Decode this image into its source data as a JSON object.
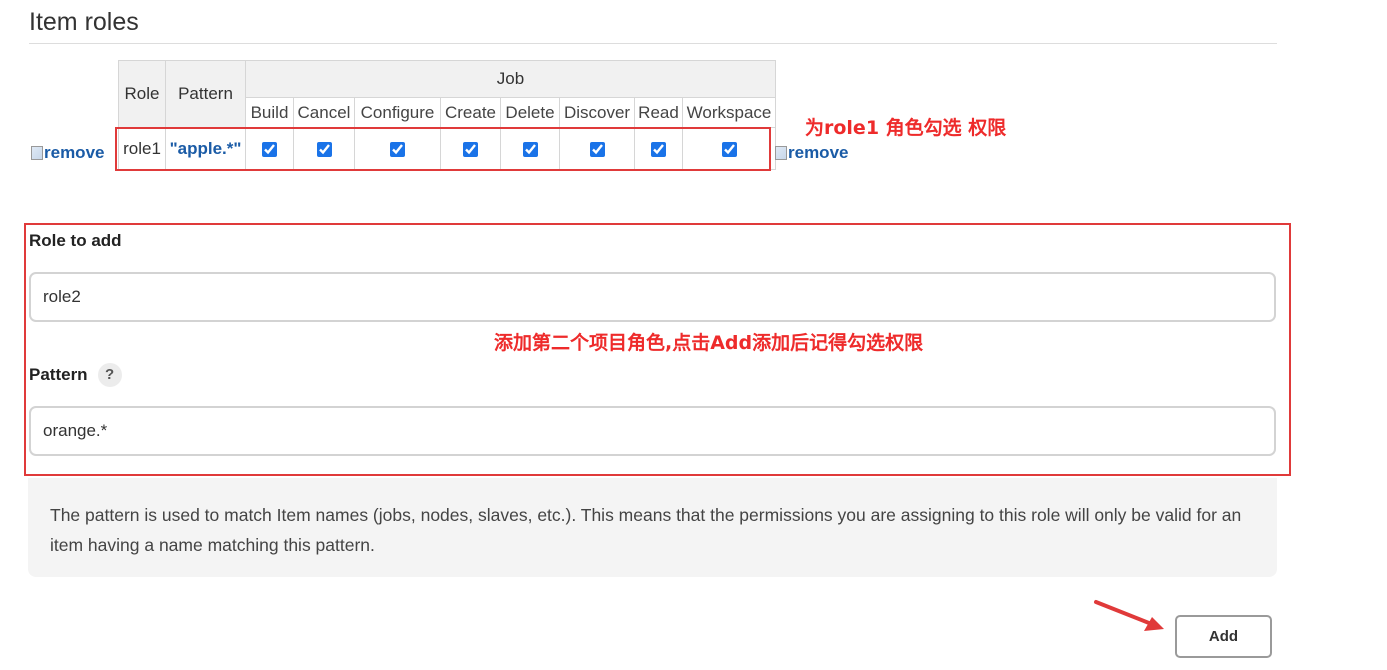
{
  "section_title": "Item roles",
  "table": {
    "role_header": "Role",
    "pattern_header": "Pattern",
    "job_header": "Job",
    "job_columns": [
      "Build",
      "Cancel",
      "Configure",
      "Create",
      "Delete",
      "Discover",
      "Read",
      "Workspace"
    ],
    "rows": [
      {
        "name": "role1",
        "pattern": "\"apple.*\"",
        "checked": [
          true,
          true,
          true,
          true,
          true,
          true,
          true,
          true
        ]
      }
    ]
  },
  "remove_label": "remove",
  "annotations": {
    "check_note": "为role1 角色勾选 权限",
    "add_note": "添加第二个项目角色,点击Add添加后记得勾选权限"
  },
  "form": {
    "role_label": "Role to add",
    "role_value": "role2",
    "pattern_label": "Pattern",
    "help_glyph": "?",
    "pattern_value": "orange.*",
    "help_text": "The pattern is used to match Item names (jobs, nodes, slaves, etc.). This means that the permissions you are assigning to this role will only be valid for an item having a name matching this pattern.",
    "add_label": "Add"
  },
  "colors": {
    "annotation": "#e03a3a",
    "link": "#1a5ba6",
    "checkbox": "#1a73e8"
  }
}
